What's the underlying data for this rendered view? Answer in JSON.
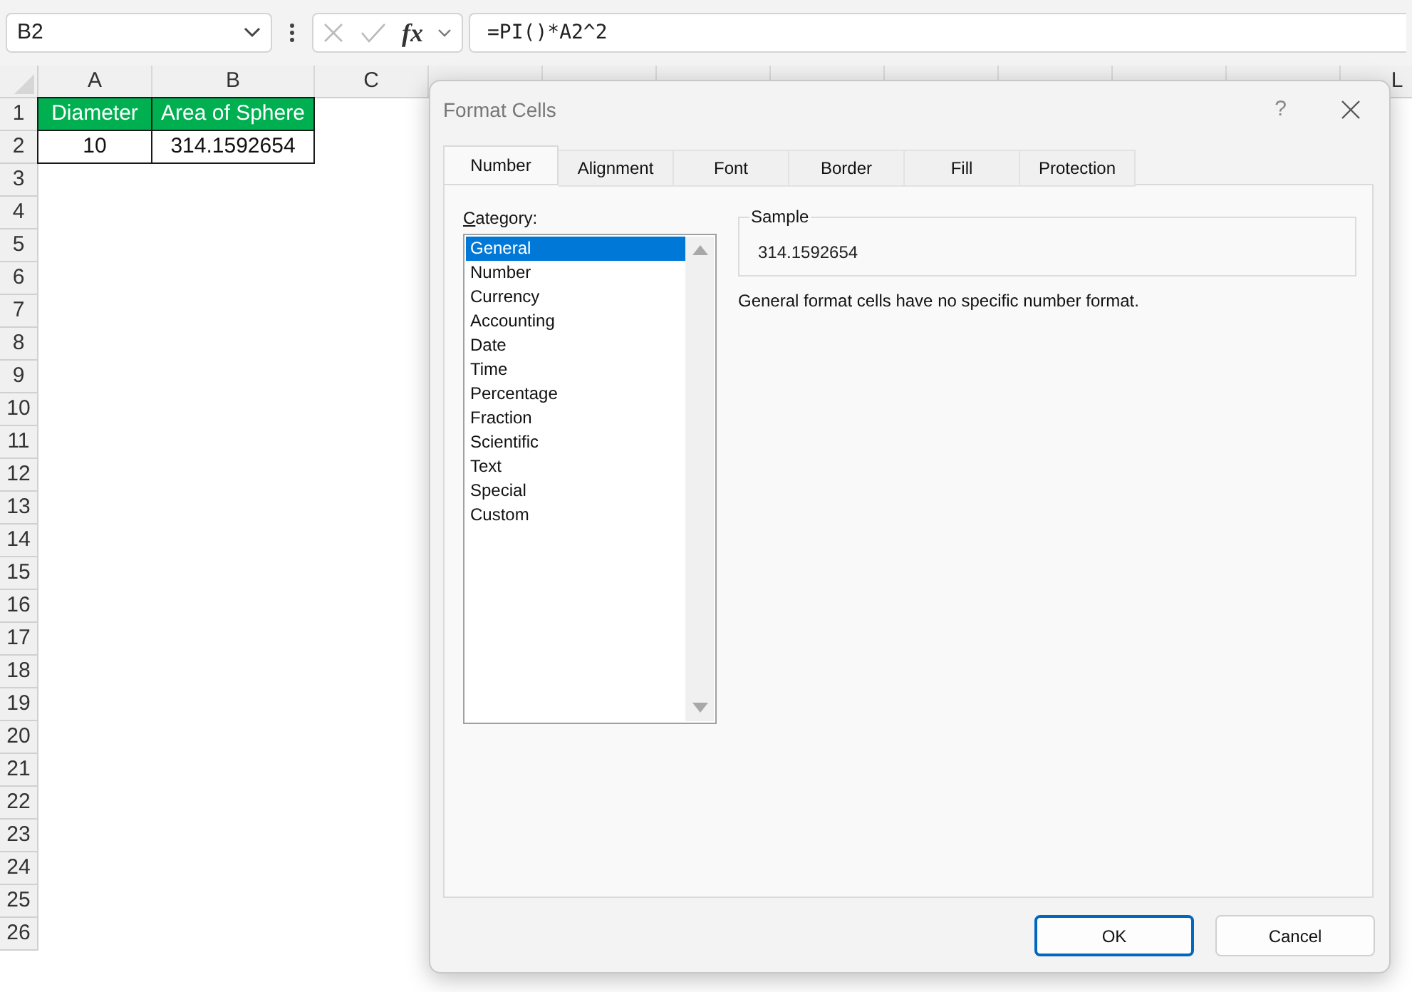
{
  "name_box": "B2",
  "formula_bar": {
    "function_label": "fx",
    "formula": "=PI()*A2^2"
  },
  "columns": [
    {
      "label": "A"
    },
    {
      "label": "B"
    },
    {
      "label": "C"
    },
    {},
    {},
    {},
    {},
    {},
    {},
    {},
    {},
    {
      "label": "L"
    }
  ],
  "sheet_rows": [
    {
      "number": "1",
      "cells": [
        {
          "text": "Diameter",
          "kind": "header"
        },
        {
          "text": "Area of Sphere",
          "kind": "header"
        }
      ]
    },
    {
      "number": "2",
      "cells": [
        {
          "text": "10",
          "kind": "value"
        },
        {
          "text": "314.1592654",
          "kind": "value"
        }
      ]
    },
    {
      "number": "3"
    },
    {
      "number": "4"
    },
    {
      "number": "5"
    },
    {
      "number": "6"
    },
    {
      "number": "7"
    },
    {
      "number": "8"
    },
    {
      "number": "9"
    },
    {
      "number": "10"
    },
    {
      "number": "11"
    },
    {
      "number": "12"
    },
    {
      "number": "13"
    },
    {
      "number": "14"
    },
    {
      "number": "15"
    },
    {
      "number": "16"
    },
    {
      "number": "17"
    },
    {
      "number": "18"
    },
    {
      "number": "19"
    },
    {
      "number": "20"
    },
    {
      "number": "21"
    },
    {
      "number": "22"
    },
    {
      "number": "23"
    },
    {
      "number": "24"
    },
    {
      "number": "25"
    },
    {
      "number": "26"
    }
  ],
  "dialog": {
    "title": "Format Cells",
    "help": "?",
    "tabs": [
      {
        "label": "Number",
        "selected": true
      },
      {
        "label": "Alignment",
        "selected": false
      },
      {
        "label": "Font",
        "selected": false
      },
      {
        "label": "Border",
        "selected": false
      },
      {
        "label": "Fill",
        "selected": false
      },
      {
        "label": "Protection",
        "selected": false
      }
    ],
    "category_label": "Category:",
    "categories": [
      {
        "label": "General",
        "selected": true
      },
      {
        "label": "Number",
        "selected": false
      },
      {
        "label": "Currency",
        "selected": false
      },
      {
        "label": "Accounting",
        "selected": false
      },
      {
        "label": "Date",
        "selected": false
      },
      {
        "label": "Time",
        "selected": false
      },
      {
        "label": "Percentage",
        "selected": false
      },
      {
        "label": "Fraction",
        "selected": false
      },
      {
        "label": "Scientific",
        "selected": false
      },
      {
        "label": "Text",
        "selected": false
      },
      {
        "label": "Special",
        "selected": false
      },
      {
        "label": "Custom",
        "selected": false
      }
    ],
    "sample": {
      "legend": "Sample",
      "value": "314.1592654"
    },
    "description": "General format cells have no specific number format.",
    "buttons": [
      {
        "label": "OK",
        "kind": "default"
      },
      {
        "label": "Cancel",
        "kind": "normal"
      }
    ]
  }
}
